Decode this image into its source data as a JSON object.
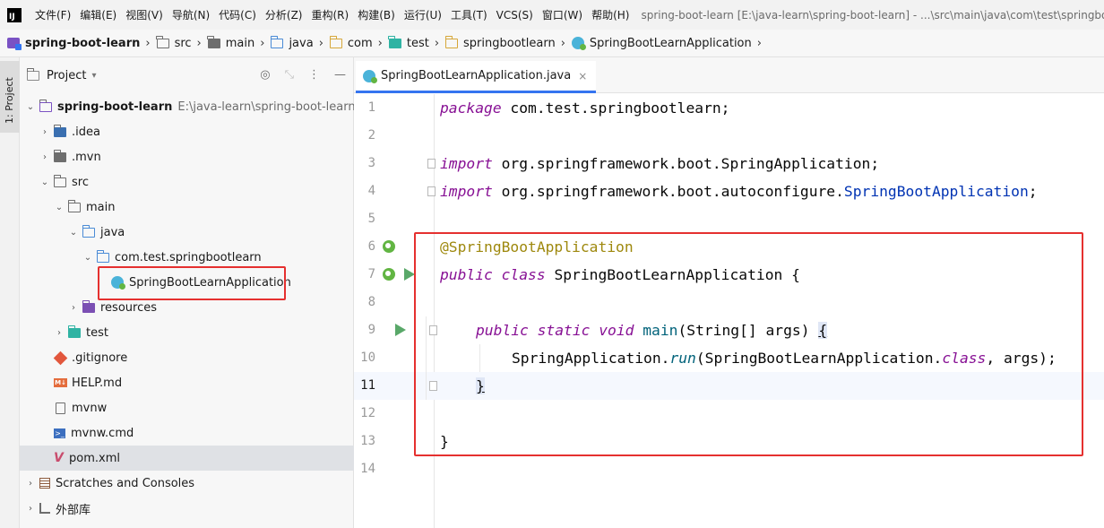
{
  "menubar": {
    "items": [
      "文件(F)",
      "编辑(E)",
      "视图(V)",
      "导航(N)",
      "代码(C)",
      "分析(Z)",
      "重构(R)",
      "构建(B)",
      "运行(U)",
      "工具(T)",
      "VCS(S)",
      "窗口(W)",
      "帮助(H)"
    ],
    "window_title": "spring-boot-learn [E:\\java-learn\\spring-boot-learn] - ...\\src\\main\\java\\com\\test\\springbootlearn"
  },
  "breadcrumb": [
    "spring-boot-learn",
    "src",
    "main",
    "java",
    "com",
    "test",
    "springbootlearn",
    "SpringBootLearnApplication"
  ],
  "tool_strip": {
    "project_tab": "1: Project"
  },
  "project_panel": {
    "title": "Project",
    "tree": [
      {
        "label": "spring-boot-learn",
        "path": "E:\\java-learn\\spring-boot-learn"
      },
      {
        "label": ".idea"
      },
      {
        "label": ".mvn"
      },
      {
        "label": "src"
      },
      {
        "label": "main"
      },
      {
        "label": "java"
      },
      {
        "label": "com.test.springbootlearn"
      },
      {
        "label": "SpringBootLearnApplication"
      },
      {
        "label": "resources"
      },
      {
        "label": "test"
      },
      {
        "label": ".gitignore"
      },
      {
        "label": "HELP.md"
      },
      {
        "label": "mvnw"
      },
      {
        "label": "mvnw.cmd"
      },
      {
        "label": "pom.xml"
      },
      {
        "label": "Scratches and Consoles"
      },
      {
        "label": "外部库"
      }
    ]
  },
  "editor": {
    "tab_label": "SpringBootLearnApplication.java",
    "current_line": 11,
    "line_numbers": [
      "1",
      "2",
      "3",
      "4",
      "5",
      "6",
      "7",
      "8",
      "9",
      "10",
      "11",
      "12",
      "13",
      "14"
    ],
    "code": {
      "l1_kw": "package",
      "l1_rest": " com.test.springbootlearn;",
      "l3_kw": "import",
      "l3_rest": " org.springframework.boot.SpringApplication;",
      "l4_kw": "import",
      "l4_pkg": " org.springframework.boot.autoconfigure.",
      "l4_cls": "SpringBootApplication",
      "l4_end": ";",
      "l6_ann": "@SpringBootApplication",
      "l7_kw": "public class",
      "l7_rest": " SpringBootLearnApplication {",
      "l9_kw": "public static void",
      "l9_fn": " main",
      "l9_rest": "(String[] args) ",
      "l9_brace": "{",
      "l10_cls": "SpringApplication.",
      "l10_fn": "run",
      "l10_mid": "(SpringBootLearnApplication.",
      "l10_kw": "class",
      "l10_end": ", args);",
      "l11_brace": "}",
      "l13_brace": "}"
    }
  },
  "colors": {
    "keyword": "#871094",
    "annotation": "#9e880d",
    "function": "#00627a",
    "import_class": "#0033b3",
    "highlight_box": "#e5302f",
    "tab_underline": "#3574f0",
    "run_icon": "#59a869"
  },
  "icons": [
    "search-icon",
    "settings-icon",
    "run-icon",
    "bean-icon",
    "folder-icon",
    "close-icon"
  ]
}
